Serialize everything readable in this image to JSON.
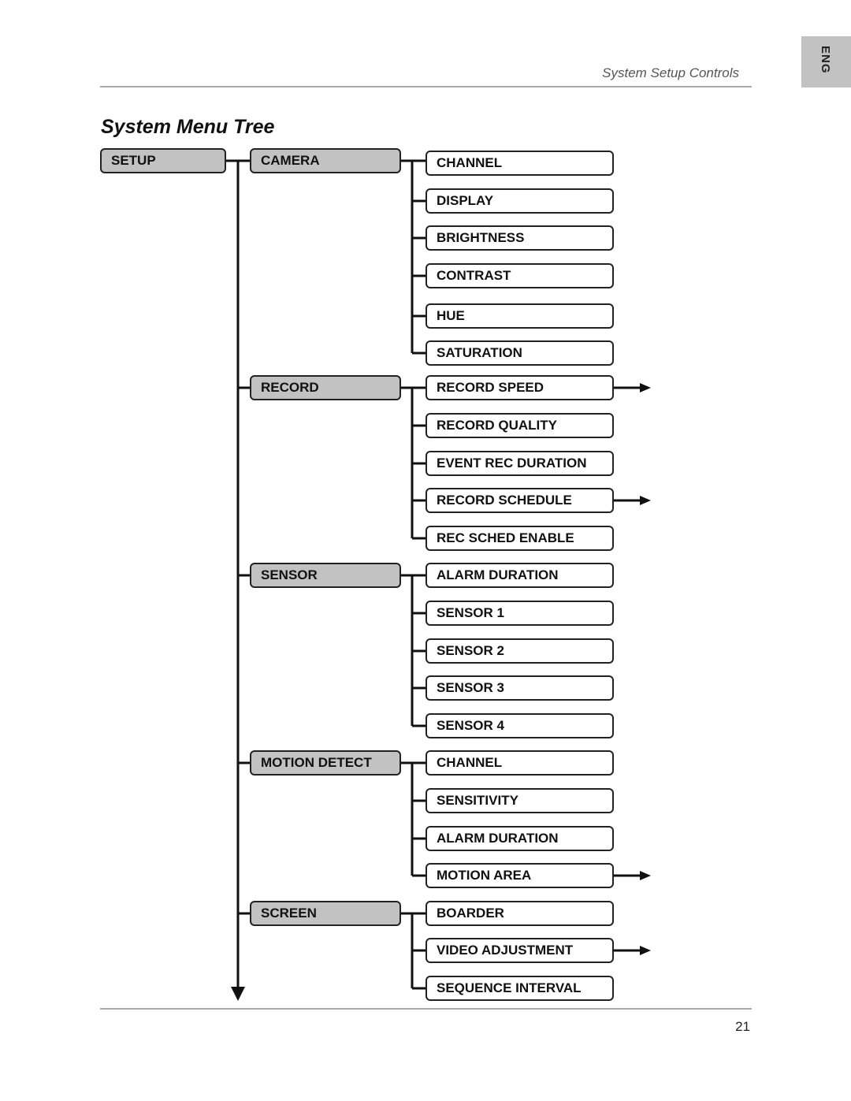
{
  "header": {
    "section_title": "System Setup Controls",
    "language_tab": "ENG"
  },
  "page_title": "System Menu Tree",
  "tree": {
    "root": "SETUP",
    "categories": [
      {
        "label": "CAMERA",
        "items": [
          {
            "label": "CHANNEL",
            "has_submenu": false
          },
          {
            "label": "DISPLAY",
            "has_submenu": false
          },
          {
            "label": "BRIGHTNESS",
            "has_submenu": false
          },
          {
            "label": "CONTRAST",
            "has_submenu": false
          },
          {
            "label": "HUE",
            "has_submenu": false
          },
          {
            "label": "SATURATION",
            "has_submenu": false
          }
        ]
      },
      {
        "label": "RECORD",
        "items": [
          {
            "label": "RECORD SPEED",
            "has_submenu": true
          },
          {
            "label": "RECORD QUALITY",
            "has_submenu": false
          },
          {
            "label": "EVENT REC DURATION",
            "has_submenu": false
          },
          {
            "label": "RECORD SCHEDULE",
            "has_submenu": true
          },
          {
            "label": "REC SCHED ENABLE",
            "has_submenu": false
          }
        ]
      },
      {
        "label": "SENSOR",
        "items": [
          {
            "label": "ALARM DURATION",
            "has_submenu": false
          },
          {
            "label": "SENSOR 1",
            "has_submenu": false
          },
          {
            "label": "SENSOR 2",
            "has_submenu": false
          },
          {
            "label": "SENSOR 3",
            "has_submenu": false
          },
          {
            "label": "SENSOR 4",
            "has_submenu": false
          }
        ]
      },
      {
        "label": "MOTION DETECT",
        "items": [
          {
            "label": "CHANNEL",
            "has_submenu": false
          },
          {
            "label": "SENSITIVITY",
            "has_submenu": false
          },
          {
            "label": "ALARM DURATION",
            "has_submenu": false
          },
          {
            "label": "MOTION AREA",
            "has_submenu": true
          }
        ]
      },
      {
        "label": "SCREEN",
        "items": [
          {
            "label": "BOARDER",
            "has_submenu": false
          },
          {
            "label": "VIDEO ADJUSTMENT",
            "has_submenu": true
          },
          {
            "label": "SEQUENCE INTERVAL",
            "has_submenu": false
          }
        ]
      }
    ]
  },
  "footer": {
    "page_number": "21"
  }
}
